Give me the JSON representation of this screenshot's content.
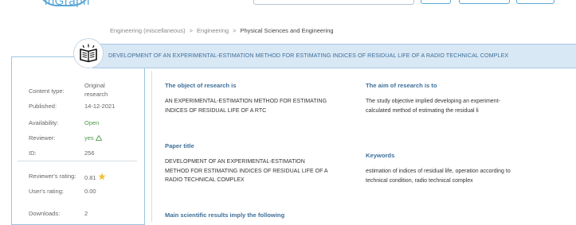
{
  "header": {
    "logo_text": "inGraph"
  },
  "breadcrumb": {
    "items": [
      "Engineering (miscellaneous)",
      "Engineering",
      "Physical Sciences and Engineering"
    ],
    "separator": ">"
  },
  "title": "DEVELOPMENT OF AN EXPERIMENTAL-ESTIMATION METHOD FOR ESTIMATING INDICES OF RESIDUAL LIFE OF A RADIO TECHNICAL COMPLEX",
  "sidebar": {
    "content_type_label": "Content type:",
    "content_type_value_1": "Original",
    "content_type_value_2": "research",
    "published_label": "Published:",
    "published_value": "14-12-2021",
    "availability_label": "Availability:",
    "availability_value": "Open",
    "reviewer_label": "Reviewer:",
    "reviewer_value": "yes",
    "id_label": "ID:",
    "id_value": "256",
    "reviewers_rating_label": "Reviewer's rating:",
    "reviewers_rating_value": "0.81",
    "users_rating_label": "User's rating:",
    "users_rating_value": "0.00",
    "downloads_label": "Downloads:",
    "downloads_value": "2"
  },
  "main": {
    "object_heading": "The object of research is",
    "object_line_1": "AN EXPERIMENTAL-ESTIMATION METHOD FOR ESTIMATING",
    "object_line_2": "INDICES OF RESIDUAL LIFE OF A RTC",
    "aim_heading": "The aim of research is to",
    "aim_line_1": "The study objective implied developing an experiment-",
    "aim_line_2": "calculated method of estimating the residual li",
    "paper_title_heading": "Paper title",
    "paper_title_line_1": "DEVELOPMENT OF AN EXPERIMENTAL-ESTIMATION",
    "paper_title_line_2": "METHOD FOR ESTIMATING INDICES OF RESIDUAL LIFE OF A",
    "paper_title_line_3": "RADIO TECHNICAL COMPLEX",
    "keywords_heading": "Keywords",
    "keywords_line_1": "estimation of indices of residual life, operation according to",
    "keywords_line_2": "technical condition, radio technical complex",
    "results_heading": "Main scientific results imply the following"
  },
  "colors": {
    "accent": "#3d6f99",
    "banner": "#d9e8f5",
    "border": "#9cc4e0",
    "open_green": "#4d9a4d",
    "star_yellow": "#f2c230"
  }
}
